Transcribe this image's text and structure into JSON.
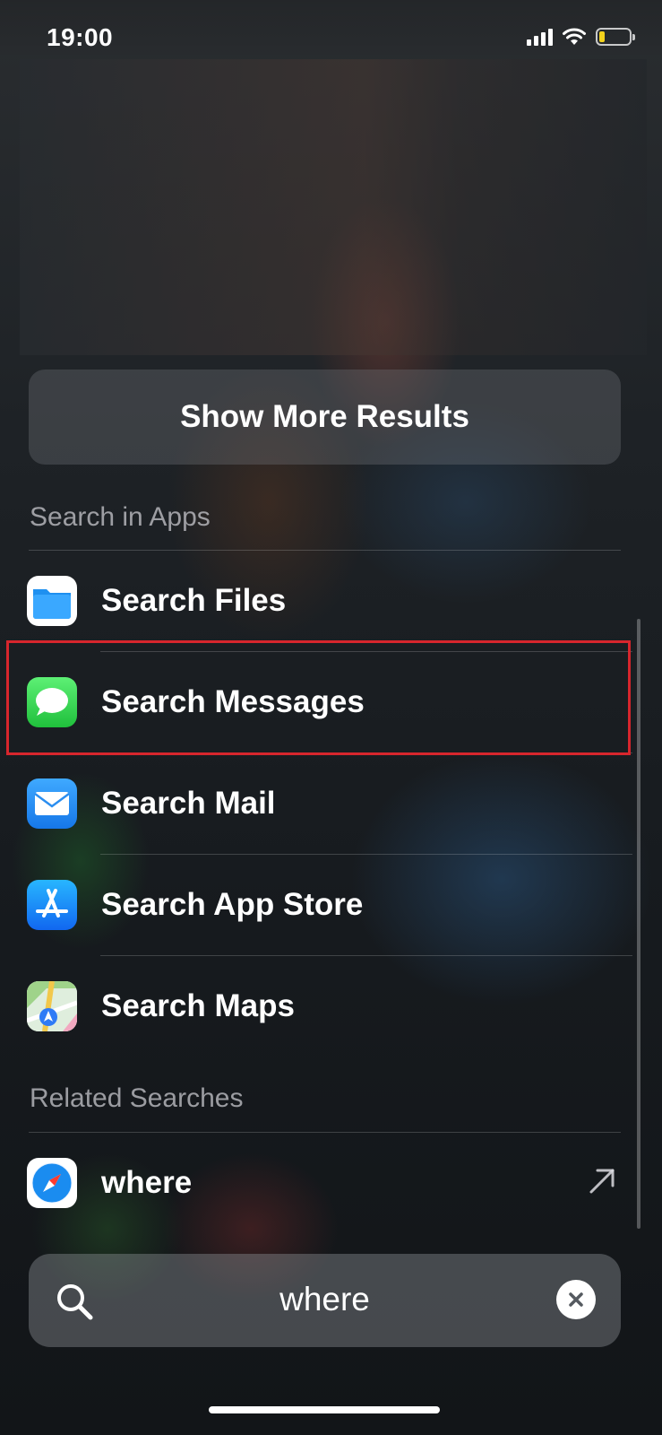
{
  "status_bar": {
    "time": "19:00",
    "signal_icon": "cellular-signal-icon",
    "wifi_icon": "wifi-icon",
    "battery_icon": "battery-icon",
    "battery_level": 0.2,
    "battery_color": "#f3d21c"
  },
  "show_more_label": "Show More Results",
  "search_in_apps": {
    "header": "Search in Apps",
    "items": [
      {
        "label": "Search Files",
        "icon": "files-app-icon"
      },
      {
        "label": "Search Messages",
        "icon": "messages-app-icon",
        "highlighted": true
      },
      {
        "label": "Search Mail",
        "icon": "mail-app-icon"
      },
      {
        "label": "Search App Store",
        "icon": "app-store-icon"
      },
      {
        "label": "Search Maps",
        "icon": "maps-app-icon"
      }
    ]
  },
  "related_searches": {
    "header": "Related Searches",
    "items": [
      {
        "label": "where",
        "icon": "safari-icon",
        "action_icon": "arrow-up-right-icon"
      }
    ]
  },
  "search_bar": {
    "value": "where",
    "icon": "search-icon",
    "clear_icon": "clear-icon"
  },
  "colors": {
    "highlight_border": "#d7262d",
    "messages_green": "#34c759",
    "files_blue": "#1e90f0",
    "mail_blue": "#2c8cf4",
    "app_store_blue": "#1a8cff"
  }
}
